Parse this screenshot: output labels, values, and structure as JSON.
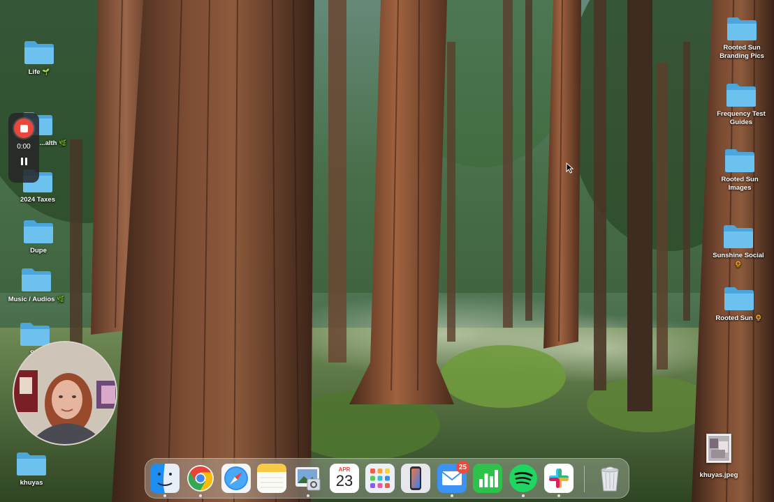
{
  "desktop": {
    "left_icons": [
      {
        "label": "Life",
        "emoji": "🌱"
      },
      {
        "label": "...alth",
        "emoji": "🌿"
      },
      {
        "label": "2024 Taxes",
        "emoji": ""
      },
      {
        "label": "Dupe",
        "emoji": ""
      },
      {
        "label": "Music / Audios",
        "emoji": "🌿"
      },
      {
        "label": "S...",
        "emoji": ""
      },
      {
        "label": "khuyas",
        "emoji": ""
      }
    ],
    "right_icons": [
      {
        "label": "Rooted Sun\nBranding Pics",
        "emoji": ""
      },
      {
        "label": "Frequency Test\nGuides",
        "emoji": ""
      },
      {
        "label": "Rooted Sun\nImages",
        "emoji": ""
      },
      {
        "label": "Sunshine Social",
        "emoji": "🌻"
      },
      {
        "label": "Rooted Sun",
        "emoji": "🌻"
      }
    ],
    "file": {
      "label": "khuyas.jpeg"
    }
  },
  "recorder": {
    "time": "0:00",
    "state": "recording"
  },
  "dock": {
    "apps": [
      {
        "name": "Finder",
        "icon": "finder-icon"
      },
      {
        "name": "Google Chrome",
        "icon": "chrome-icon"
      },
      {
        "name": "Safari",
        "icon": "safari-icon"
      },
      {
        "name": "Notes",
        "icon": "notes-icon"
      },
      {
        "name": "Preview",
        "icon": "preview-icon"
      },
      {
        "name": "Calendar",
        "icon": "calendar-icon",
        "month": "APR",
        "day": "23"
      },
      {
        "name": "Launchpad",
        "icon": "launchpad-icon"
      },
      {
        "name": "iPhone Mirroring",
        "icon": "iphone-mirroring-icon"
      },
      {
        "name": "Mail",
        "icon": "mail-icon",
        "badge": "25"
      },
      {
        "name": "Numbers",
        "icon": "numbers-icon"
      },
      {
        "name": "Spotify",
        "icon": "spotify-icon"
      },
      {
        "name": "Slack",
        "icon": "slack-icon"
      },
      {
        "name": "Trash",
        "icon": "trash-icon"
      }
    ]
  },
  "colors": {
    "folder": "#5ab4e6",
    "record_red": "#e8473e",
    "badge_red": "#f2473b"
  }
}
